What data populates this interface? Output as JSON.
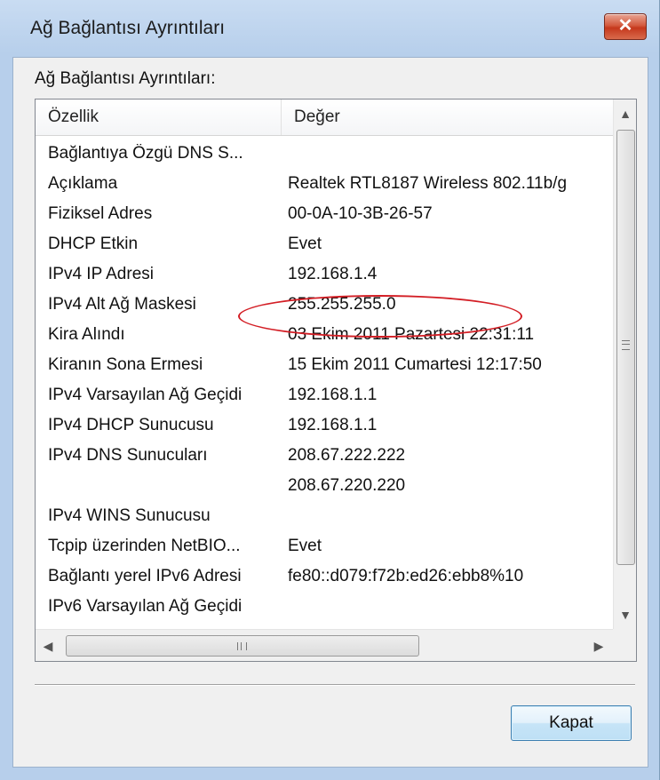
{
  "window": {
    "title": "Ağ Bağlantısı Ayrıntıları",
    "close_icon": "close-icon"
  },
  "group_label": "Ağ Bağlantısı Ayrıntıları:",
  "listview": {
    "columns": [
      "Özellik",
      "Değer"
    ],
    "rows": [
      {
        "property": "Bağlantıya Özgü DNS S...",
        "value": ""
      },
      {
        "property": "Açıklama",
        "value": "Realtek RTL8187 Wireless 802.11b/g"
      },
      {
        "property": "Fiziksel Adres",
        "value": "00-0A-10-3B-26-57"
      },
      {
        "property": "DHCP Etkin",
        "value": "Evet"
      },
      {
        "property": "IPv4 IP Adresi",
        "value": "192.168.1.4"
      },
      {
        "property": "IPv4 Alt Ağ Maskesi",
        "value": "255.255.255.0"
      },
      {
        "property": "Kira Alındı",
        "value": "03 Ekim 2011 Pazartesi 22:31:11"
      },
      {
        "property": "Kiranın Sona Ermesi",
        "value": "15 Ekim 2011 Cumartesi 12:17:50"
      },
      {
        "property": "IPv4 Varsayılan Ağ Geçidi",
        "value": "192.168.1.1"
      },
      {
        "property": "IPv4 DHCP Sunucusu",
        "value": "192.168.1.1"
      },
      {
        "property": "IPv4 DNS Sunucuları",
        "value": "208.67.222.222"
      },
      {
        "property": "",
        "value": "208.67.220.220"
      },
      {
        "property": "IPv4 WINS Sunucusu",
        "value": ""
      },
      {
        "property": "Tcpip üzerinden NetBIO...",
        "value": "Evet"
      },
      {
        "property": "Bağlantı yerel IPv6 Adresi",
        "value": "fe80::d079:f72b:ed26:ebb8%10"
      },
      {
        "property": "IPv6 Varsayılan Ağ Geçidi",
        "value": ""
      }
    ],
    "highlight_color": "#d31e25"
  },
  "scrollbars": {
    "vertical_grip": "≡",
    "horizontal_grip": "III"
  },
  "buttons": {
    "close_label": "Kapat"
  }
}
